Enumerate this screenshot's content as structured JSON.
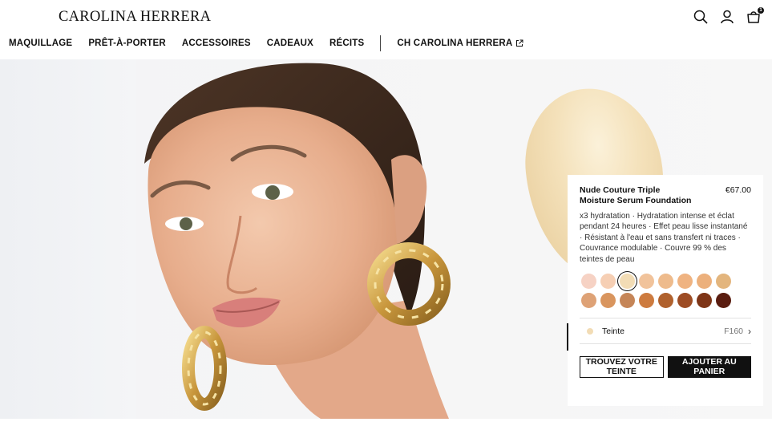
{
  "brand": {
    "logo": "CAROLINA HERRERA"
  },
  "header": {
    "icons": [
      "search-icon",
      "account-icon",
      "cart-icon"
    ],
    "cart_count": "1"
  },
  "nav": {
    "items": [
      "MAQUILLAGE",
      "PRÊT-À-PORTER",
      "ACCESSOIRES",
      "CADEAUX",
      "RÉCITS"
    ],
    "external": "CH CAROLINA HERRERA"
  },
  "product": {
    "name": "Nude Couture Triple Moisture Serum Foundation",
    "price": "€67.00",
    "description": "x3 hydratation · Hydratation intense et éclat pendant 24 heures · Effet peau lisse instantané · Résistant à l'eau et sans transfert ni traces · Couvrance modulable · Couvre 99 % des teintes de peau",
    "shades": [
      "#f6d2c4",
      "#f6cfb4",
      "#f2dcb5",
      "#f1c39b",
      "#eebb8c",
      "#efb381",
      "#ecb07c",
      "#e3b57d",
      "#dea276",
      "#d9955e",
      "#c58557",
      "#cd7b3f",
      "#b0612d",
      "#9d4c24",
      "#7e3517",
      "#5a1d10"
    ],
    "selected_shade_index": 2,
    "teinte": {
      "label": "Teinte",
      "code": "F160",
      "dot_color": "#f2dcb5"
    },
    "buttons": {
      "find_shade": "TROUVEZ VOTRE TEINTE",
      "add_to_cart": "AJOUTER AU PANIER"
    }
  }
}
